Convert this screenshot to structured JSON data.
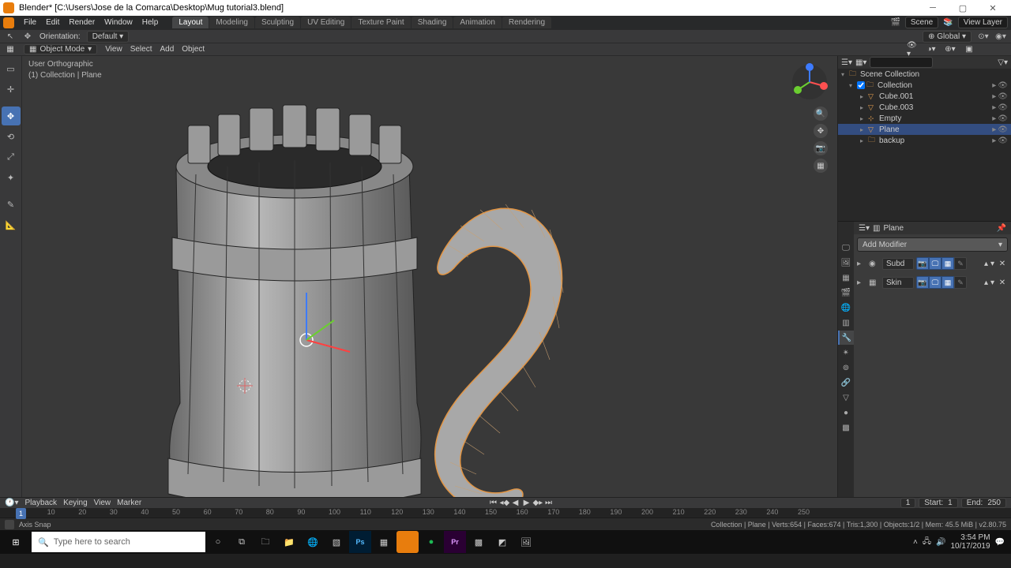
{
  "window": {
    "title": "Blender* [C:\\Users\\Jose de la Comarca\\Desktop\\Mug tutorial3.blend]"
  },
  "menu": {
    "items": [
      "File",
      "Edit",
      "Render",
      "Window",
      "Help"
    ]
  },
  "workspace_tabs": [
    "Layout",
    "Modeling",
    "Sculpting",
    "UV Editing",
    "Texture Paint",
    "Shading",
    "Animation",
    "Rendering"
  ],
  "active_tab": "Layout",
  "scene_field": "Scene",
  "viewlayer_field": "View Layer",
  "toolbar2": {
    "orientation_label": "Orientation:",
    "orientation_value": "Default",
    "transform_space": "Global"
  },
  "header3": {
    "mode": "Object Mode",
    "menus": [
      "View",
      "Select",
      "Add",
      "Object"
    ]
  },
  "overlay": {
    "line1": "User Orthographic",
    "line2": "(1) Collection | Plane"
  },
  "outliner": {
    "root": "Scene Collection",
    "collection": "Collection",
    "items": [
      {
        "name": "Cube.001",
        "icon": "mesh",
        "sel": false
      },
      {
        "name": "Cube.003",
        "icon": "mesh",
        "sel": false
      },
      {
        "name": "Empty",
        "icon": "empty",
        "sel": false
      },
      {
        "name": "Plane",
        "icon": "mesh",
        "sel": true
      },
      {
        "name": "backup",
        "icon": "coll",
        "sel": false
      }
    ]
  },
  "props": {
    "object": "Plane",
    "add_label": "Add Modifier",
    "modifiers": [
      {
        "name": "Subd",
        "icon": "subsurf"
      },
      {
        "name": "Skin",
        "icon": "skin"
      }
    ]
  },
  "timeline": {
    "menus": [
      "Playback",
      "Keying",
      "View",
      "Marker"
    ],
    "current": 1,
    "start_label": "Start:",
    "start": 1,
    "end_label": "End:",
    "end": 250,
    "ticks": [
      10,
      20,
      30,
      40,
      50,
      60,
      70,
      80,
      90,
      100,
      110,
      120,
      130,
      140,
      150,
      160,
      170,
      180,
      190,
      200,
      210,
      220,
      230,
      240,
      250
    ]
  },
  "status": {
    "left": "Axis Snap",
    "right": "Collection | Plane | Verts:654 | Faces:674 | Tris:1,300 | Objects:1/2 | Mem: 45.5 MiB | v2.80.75"
  },
  "taskbar": {
    "search_placeholder": "Type here to search",
    "time": "3:54 PM",
    "date": "10/17/2019"
  }
}
